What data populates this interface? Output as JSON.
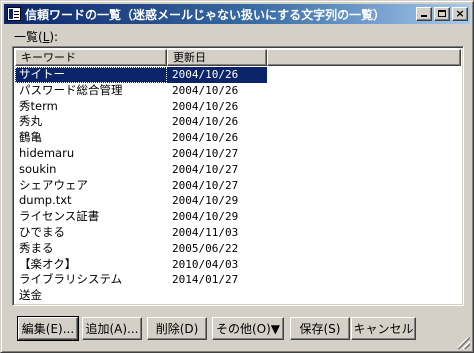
{
  "window": {
    "title": "信頼ワードの一覧（迷惑メールじゃない扱いにする文字列の一覧）",
    "minimize_label": "_",
    "maximize_label": "□",
    "close_label": "×"
  },
  "list": {
    "caption": "一覧(",
    "caption_key": "L",
    "caption_end": "):",
    "columns": [
      "キーワード",
      "更新日",
      ""
    ],
    "rows": [
      {
        "keyword": "サイトー",
        "date": "2004/10/26",
        "selected": true
      },
      {
        "keyword": "パスワード総合管理",
        "date": "2004/10/26"
      },
      {
        "keyword": "秀term",
        "date": "2004/10/26"
      },
      {
        "keyword": "秀丸",
        "date": "2004/10/26"
      },
      {
        "keyword": "鶴亀",
        "date": "2004/10/26"
      },
      {
        "keyword": "hidemaru",
        "date": "2004/10/27"
      },
      {
        "keyword": "soukin",
        "date": "2004/10/27"
      },
      {
        "keyword": "シェアウェア",
        "date": "2004/10/27"
      },
      {
        "keyword": "dump.txt",
        "date": "2004/10/29"
      },
      {
        "keyword": "ライセンス証書",
        "date": "2004/10/29"
      },
      {
        "keyword": "ひでまる",
        "date": "2004/11/03"
      },
      {
        "keyword": "秀まる",
        "date": "2005/06/22"
      },
      {
        "keyword": "【楽オク】",
        "date": "2010/04/03"
      },
      {
        "keyword": "ライブラリシステム",
        "date": "2014/01/27"
      },
      {
        "keyword": "送金",
        "date": ""
      }
    ]
  },
  "buttons": {
    "edit": "編集(E)...",
    "add": "追加(A)...",
    "delete": "削除(D)",
    "other": "その他(O)▼",
    "save": "保存(S)",
    "cancel": "キャンセル"
  },
  "colors": {
    "titlebar_start": "#0a246a",
    "titlebar_end": "#a6caf0",
    "selection": "#0a246a",
    "face": "#d4d0c8"
  }
}
